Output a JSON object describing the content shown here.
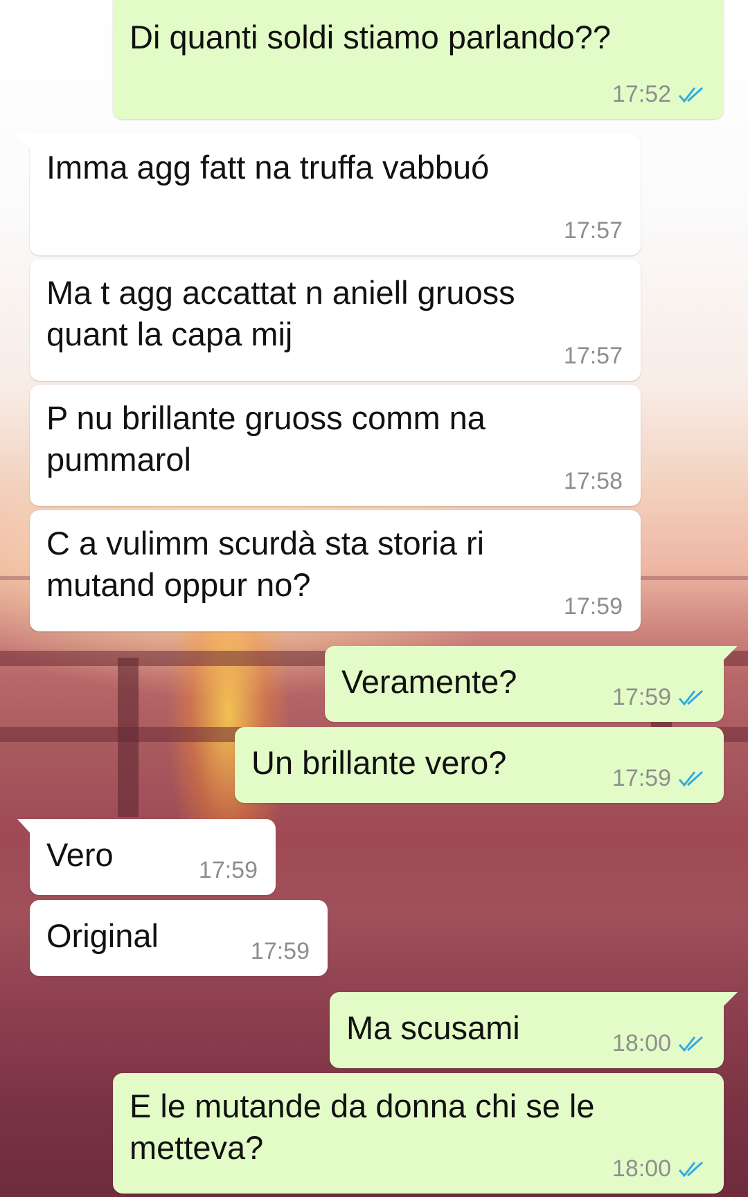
{
  "theme": {
    "incoming_color": "#ffffff",
    "outgoing_color": "#e3fcc7",
    "read_tick_color": "#34a9e0"
  },
  "messages": [
    {
      "direction": "out",
      "text": "Di quanti soldi stiamo parlando??",
      "time": "17:52",
      "status_icon": "double-check-read-icon"
    },
    {
      "direction": "in",
      "text": "Imma agg fatt na truffa vabbuó",
      "time": "17:57"
    },
    {
      "direction": "in",
      "text": "Ma t agg accattat n aniell gruoss",
      "text2": "quant la capa mij",
      "time": "17:57"
    },
    {
      "direction": "in",
      "text": "P nu brillante gruoss comm na",
      "text2": "pummarol",
      "time": "17:58"
    },
    {
      "direction": "in",
      "text": "C a vulimm scurdà sta storia ri",
      "text2": "mutand oppur no?",
      "time": "17:59"
    },
    {
      "direction": "out",
      "text": "Veramente?",
      "time": "17:59",
      "status_icon": "double-check-read-icon"
    },
    {
      "direction": "out",
      "text": "Un brillante vero?",
      "time": "17:59",
      "status_icon": "double-check-read-icon"
    },
    {
      "direction": "in",
      "text": "Vero",
      "time": "17:59"
    },
    {
      "direction": "in",
      "text": "Original",
      "time": "17:59"
    },
    {
      "direction": "out",
      "text": "Ma scusami",
      "time": "18:00",
      "status_icon": "double-check-read-icon"
    },
    {
      "direction": "out",
      "text": "E le mutande da donna chi se le",
      "text2": "metteva?",
      "time": "18:00",
      "status_icon": "double-check-read-icon"
    }
  ]
}
